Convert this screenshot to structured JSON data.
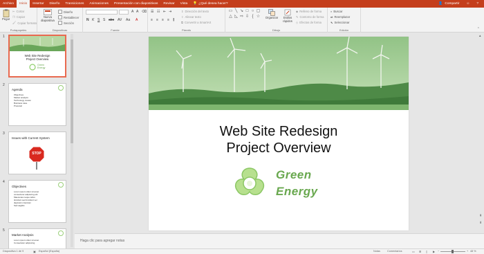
{
  "tabs": [
    {
      "label": "Archivo",
      "active": false
    },
    {
      "label": "Inicio",
      "active": true
    },
    {
      "label": "Insertar",
      "active": false
    },
    {
      "label": "Diseño",
      "active": false
    },
    {
      "label": "Transiciones",
      "active": false
    },
    {
      "label": "Animaciones",
      "active": false
    },
    {
      "label": "Presentación con diapositivas",
      "active": false
    },
    {
      "label": "Revisar",
      "active": false
    },
    {
      "label": "Vista",
      "active": false
    }
  ],
  "tell_me": "¿Qué desea hacer?",
  "share_label": "Compartir",
  "ribbon": {
    "clipboard": {
      "paste": "Pegar",
      "cut": "Cortar",
      "copy": "Copiar",
      "format_painter": "Copiar formato",
      "label": "Portapapeles"
    },
    "slides": {
      "new_slide": "Nueva diapositiva",
      "layout": "Diseño",
      "reset": "Restablecer",
      "section": "Sección",
      "label": "Diapositivas"
    },
    "font": {
      "label": "Fuente"
    },
    "paragraph": {
      "direction": "Dirección del texto",
      "align": "Alinear texto",
      "smartart": "Convertir a SmartArt",
      "label": "Párrafo"
    },
    "drawing": {
      "arrange": "Organizar",
      "quick_styles": "Estilos rápidos",
      "fill": "Relleno de forma",
      "outline": "Contorno de forma",
      "effects": "Efectos de forma",
      "label": "Dibujo"
    },
    "editing": {
      "find": "Buscar",
      "replace": "Reemplazar",
      "select": "Seleccionar",
      "label": "Edición"
    }
  },
  "thumbnails": [
    {
      "num": "1",
      "title": "Web Site Redesign\nProject Overview",
      "bullets": []
    },
    {
      "num": "2",
      "title": "Agenda",
      "bullets": [
        "Objectives",
        "Market analysis",
        "Technology review",
        "Business case",
        "Proposal"
      ]
    },
    {
      "num": "3",
      "title": "Issues with Current System",
      "bullets": []
    },
    {
      "num": "4",
      "title": "Objectives",
      "bullets": [
        "Lorem ipsum dolor sit amet",
        "consectetur adipiscing elit",
        "Maecenas neque tellus",
        "tincidunt sed tincidunt vel",
        "dignissim interdum",
        "Sed sagittis"
      ]
    },
    {
      "num": "5",
      "title": "Market Analysis",
      "bullets": [
        "Lorem ipsum dolor sit amet",
        "Consectetur adipiscing"
      ]
    }
  ],
  "stop_sign_text": "STOP",
  "slide": {
    "title_line1": "Web Site Redesign",
    "title_line2": "Project Overview",
    "logo_line1": "Green",
    "logo_line2": "Energy"
  },
  "notes_placeholder": "Haga clic para agregar notas",
  "status": {
    "slide_counter": "Diapositiva 1 de 9",
    "language": "Español (España)",
    "notes": "Notas",
    "comments": "Comentarios",
    "zoom": "48 %"
  },
  "colors": {
    "accent": "#c43e1c",
    "green": "#69a84f",
    "selection": "#e9694f"
  }
}
